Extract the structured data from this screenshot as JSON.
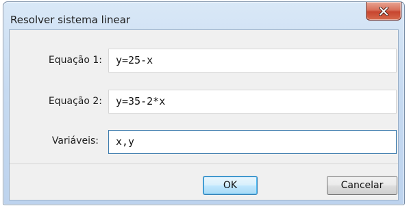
{
  "window": {
    "title": "Resolver sistema linear"
  },
  "form": {
    "equation1_label": "Equação 1:",
    "equation1_value": "y=25-x",
    "equation2_label": "Equação 2:",
    "equation2_value": "y=35-2*x",
    "variables_label": "Variáveis:",
    "variables_value": "x,y"
  },
  "buttons": {
    "ok_label": "OK",
    "cancel_label": "Cancelar"
  },
  "icons": {
    "close": "close-icon"
  }
}
